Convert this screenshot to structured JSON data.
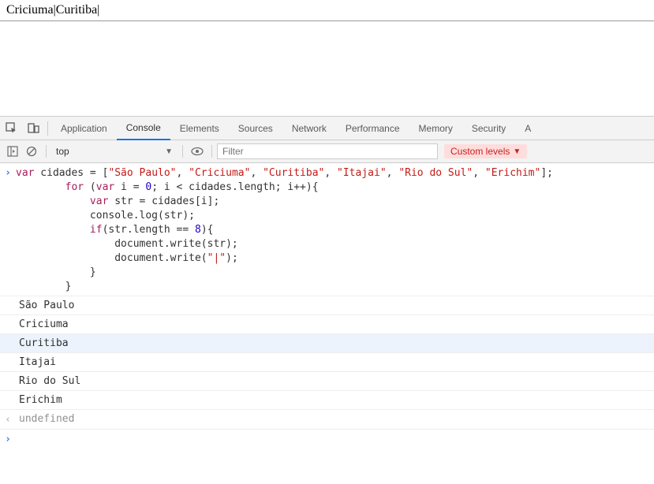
{
  "document_output": "Criciuma|Curitiba|",
  "tabs": {
    "application": "Application",
    "console": "Console",
    "elements": "Elements",
    "sources": "Sources",
    "network": "Network",
    "performance": "Performance",
    "memory": "Memory",
    "security": "Security",
    "more": "A"
  },
  "toolbar": {
    "context": "top",
    "filter_placeholder": "Filter",
    "levels_label": "Custom levels"
  },
  "code": {
    "l1a": "var",
    "l1b": " cidades = [",
    "l1s1": "\"São Paulo\"",
    "l1c": ", ",
    "l1s2": "\"Criciuma\"",
    "l1s3": "\"Curitiba\"",
    "l1s4": "\"Itajai\"",
    "l1s5": "\"Rio do Sul\"",
    "l1s6": "\"Erichim\"",
    "l1d": "];",
    "l2a": "        for",
    "l2b": " (",
    "l2c": "var",
    "l2d": " i = ",
    "l2n": "0",
    "l2e": "; i < cidades.length; i++){",
    "l3a": "            var",
    "l3b": " str = cidades[i];",
    "l4": "            console.log(str);",
    "l5a": "            if",
    "l5b": "(str.length == ",
    "l5n": "8",
    "l5c": "){",
    "l6": "                document.write(str);",
    "l7a": "                document.write(",
    "l7s": "\"|\"",
    "l7b": ");",
    "l8": "            }",
    "l9": "        }"
  },
  "logs": [
    "São Paulo",
    "Criciuma",
    "Curitiba",
    "Itajai",
    "Rio do Sul",
    "Erichim"
  ],
  "result": "undefined",
  "highlight_index": 2
}
